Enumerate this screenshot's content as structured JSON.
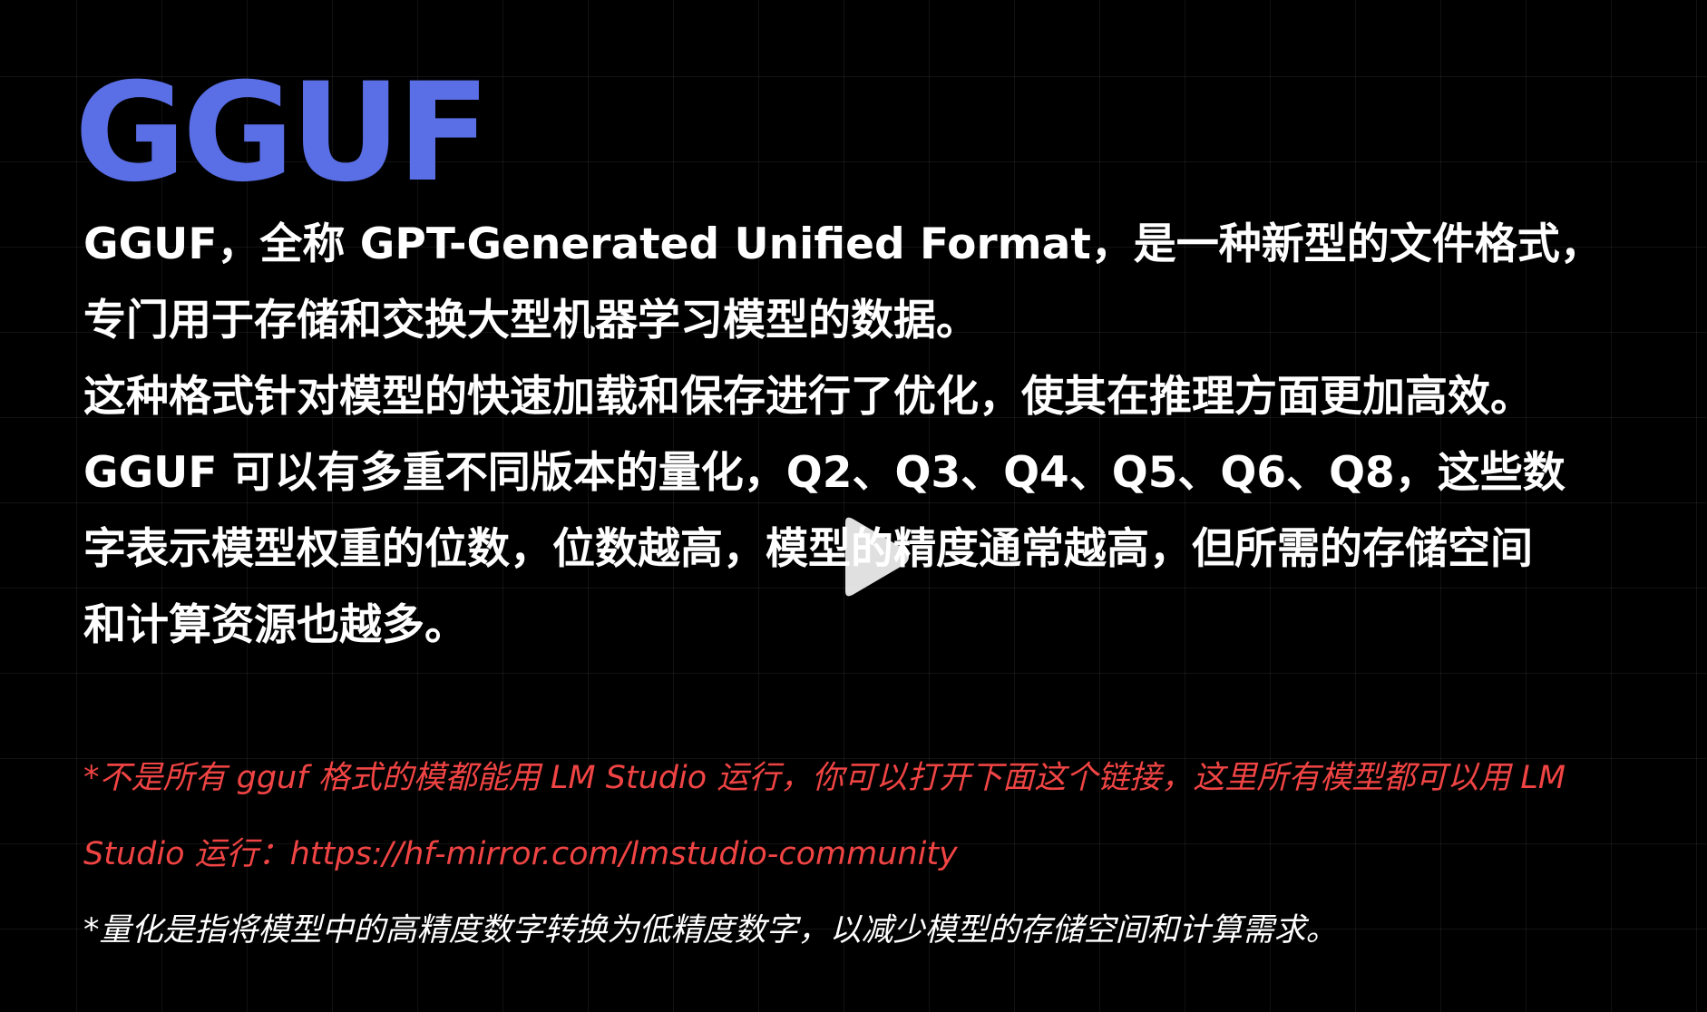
{
  "title": "GGUF",
  "body": {
    "line_1": "GGUF，全称 GPT-Generated Unified Format，是一种新型的文件格式，",
    "line_2": "专门用于存储和交换大型机器学习模型的数据。",
    "line_3": "这种格式针对模型的快速加载和保存进行了优化，使其在推理方面更加高效。",
    "line_4": "GGUF 可以有多重不同版本的量化，Q2、Q3、Q4、Q5、Q6、Q8，这些数",
    "line_5": "字表示模型权重的位数，位数越高，模型的精度通常越高，但所需的存储空间",
    "line_6": "和计算资源也越多。"
  },
  "notes": {
    "red_text": "*不是所有 gguf 格式的模都能用 LM Studio 运行，你可以打开下面这个链接，这里所有模型都可以用 LM Studio 运行：",
    "red_link": "https://hf-mirror.com/lmstudio-community",
    "white_text": "*量化是指将模型中的高精度数字转换为低精度数字，以减少模型的存储空间和计算需求。"
  },
  "play_icon": "play-icon",
  "colors": {
    "background": "#000000",
    "title": "#5a6fe6",
    "body": "#ffffff",
    "note_red": "#f04444",
    "note_white": "#ffffff"
  }
}
